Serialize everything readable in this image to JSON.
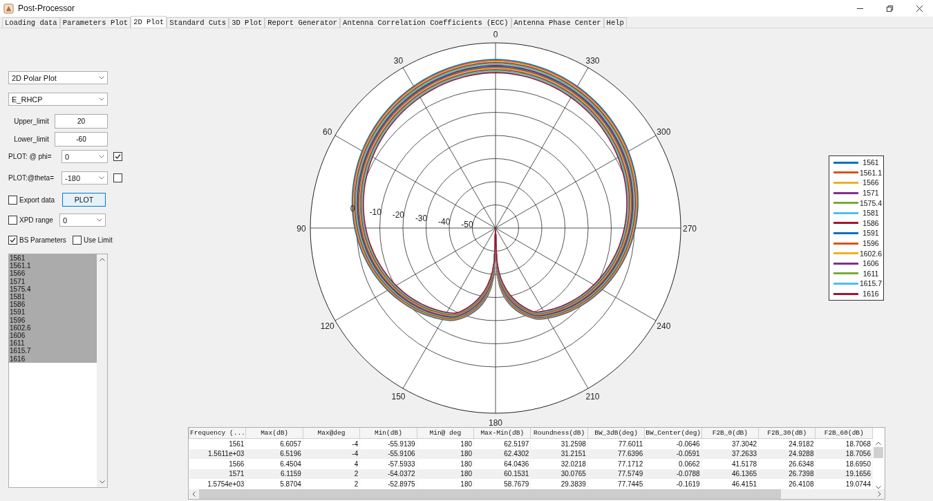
{
  "window": {
    "title": "Post-Processor"
  },
  "tabs": [
    {
      "label": "Loading data",
      "selected": false
    },
    {
      "label": "Parameters Plot",
      "selected": false
    },
    {
      "label": "2D Plot",
      "selected": true
    },
    {
      "label": "Standard Cuts",
      "selected": false
    },
    {
      "label": "3D Plot",
      "selected": false
    },
    {
      "label": "Report Generator",
      "selected": false
    },
    {
      "label": "Antenna Correlation Coefficients (ECC)",
      "selected": false
    },
    {
      "label": "Antenna Phase Center",
      "selected": false
    },
    {
      "label": "Help",
      "selected": false
    }
  ],
  "controls": {
    "plot_type": {
      "value": "2D Polar Plot"
    },
    "field": {
      "value": "E_RHCP"
    },
    "upper_limit": {
      "label": "Upper_limit",
      "value": "20"
    },
    "lower_limit": {
      "label": "Lower_limit",
      "value": "-60"
    },
    "phi": {
      "label": "PLOT: @ phi=",
      "value": "0",
      "checked": true
    },
    "theta": {
      "label": "PLOT:@theta=",
      "value": "-180",
      "checked": false
    },
    "export_data": {
      "label": "Export data",
      "checked": false
    },
    "plot_button": {
      "label": "PLOT"
    },
    "xpd_range": {
      "label": "XPD range",
      "checked": false,
      "value": "0"
    },
    "bs_parameters": {
      "label": "BS Parameters",
      "checked": true
    },
    "use_limit": {
      "label": "Use Limit",
      "checked": false
    }
  },
  "frequency_list": [
    {
      "label": "1561",
      "selected": true
    },
    {
      "label": "1561.1",
      "selected": true
    },
    {
      "label": "1566",
      "selected": true
    },
    {
      "label": "1571",
      "selected": true
    },
    {
      "label": "1575.4",
      "selected": true
    },
    {
      "label": "1581",
      "selected": true
    },
    {
      "label": "1586",
      "selected": true
    },
    {
      "label": "1591",
      "selected": true
    },
    {
      "label": "1596",
      "selected": true
    },
    {
      "label": "1602.6",
      "selected": true
    },
    {
      "label": "1606",
      "selected": true
    },
    {
      "label": "1611",
      "selected": true
    },
    {
      "label": "1615.7",
      "selected": true
    },
    {
      "label": "1616",
      "selected": true
    }
  ],
  "polar_plot": {
    "angle_labels": [
      "0",
      "30",
      "60",
      "90",
      "120",
      "150",
      "180",
      "210",
      "240",
      "270",
      "300",
      "330"
    ],
    "ring_labels": [
      "0",
      "-10",
      "-20",
      "-30",
      "-40",
      "-50"
    ]
  },
  "legend": [
    {
      "label": "1561",
      "color": "#0072bd"
    },
    {
      "label": "1561.1",
      "color": "#d95319"
    },
    {
      "label": "1566",
      "color": "#edb120"
    },
    {
      "label": "1571",
      "color": "#7e2f8e"
    },
    {
      "label": "1575.4",
      "color": "#77ac30"
    },
    {
      "label": "1581",
      "color": "#4dbeee"
    },
    {
      "label": "1586",
      "color": "#a2142f"
    },
    {
      "label": "1591",
      "color": "#0072bd"
    },
    {
      "label": "1596",
      "color": "#d95319"
    },
    {
      "label": "1602.6",
      "color": "#edb120"
    },
    {
      "label": "1606",
      "color": "#7e2f8e"
    },
    {
      "label": "1611",
      "color": "#77ac30"
    },
    {
      "label": "1615.7",
      "color": "#4dbeee"
    },
    {
      "label": "1616",
      "color": "#a2142f"
    }
  ],
  "results_table": {
    "columns": [
      "Frequency (...",
      "Max(dB)",
      "Max@deg",
      "Min(dB)",
      "Min@ deg",
      "Max-Min(dB)",
      "Roundness(dB)",
      "BW_3dB(deg)",
      "BW_Center(deg)",
      "F2B_0(dB)",
      "F2B_30(dB)",
      "F2B_60(dB)"
    ],
    "rows": [
      [
        "1561",
        "6.6057",
        "-4",
        "-55.9139",
        "180",
        "62.5197",
        "31.2598",
        "77.6011",
        "-0.0646",
        "37.3042",
        "24.9182",
        "18.7068"
      ],
      [
        "1.5611e+03",
        "6.5196",
        "-4",
        "-55.9106",
        "180",
        "62.4302",
        "31.2151",
        "77.6396",
        "-0.0591",
        "37.2633",
        "24.9288",
        "18.7056"
      ],
      [
        "1566",
        "6.4504",
        "4",
        "-57.5933",
        "180",
        "64.0436",
        "32.0218",
        "77.1712",
        "0.0662",
        "41.5178",
        "26.6348",
        "18.6950"
      ],
      [
        "1571",
        "6.1159",
        "2",
        "-54.0372",
        "180",
        "60.1531",
        "30.0765",
        "77.5749",
        "-0.0788",
        "46.1365",
        "26.7398",
        "19.1656"
      ],
      [
        "1.5754e+03",
        "5.8704",
        "2",
        "-52.8975",
        "180",
        "58.7679",
        "29.3839",
        "77.7445",
        "-0.1619",
        "46.4151",
        "26.4108",
        "19.0744"
      ]
    ]
  }
}
